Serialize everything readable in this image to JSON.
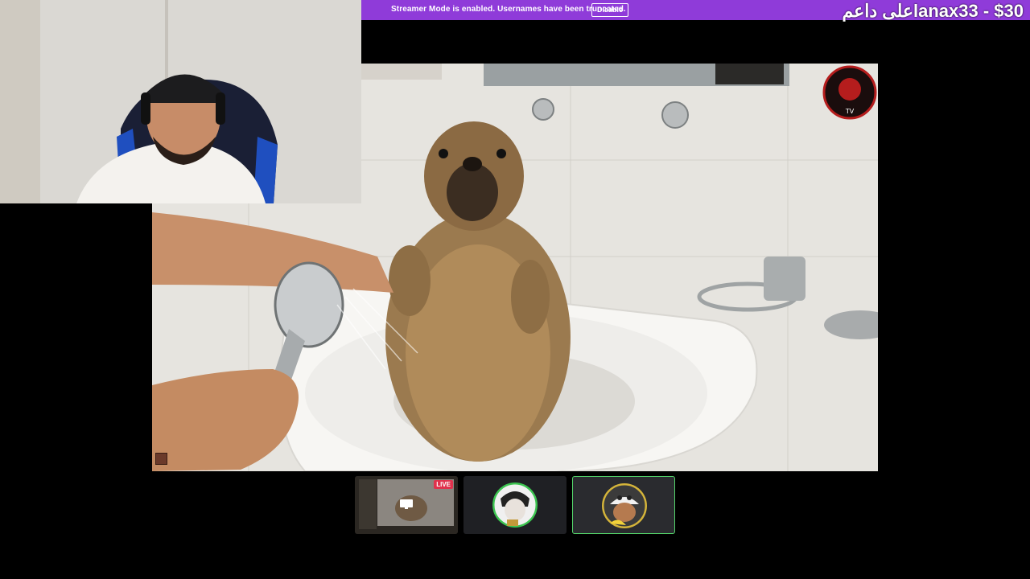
{
  "banner": {
    "message": "Streamer Mode is enabled. Usernames have been truncated.",
    "disable_label": "Disable"
  },
  "donation_text": "lanax33 - $30على داعم",
  "tiles": {
    "stream_preview": {
      "live_label": "LIVE",
      "icon": "screen-share-icon"
    },
    "participant_1": {
      "icon": "avatar-manga-character"
    },
    "participant_2": {
      "icon": "avatar-pirate-character"
    }
  },
  "colors": {
    "banner": "#8f3bd9",
    "live": "#e0324d",
    "active_border": "#53d36a"
  },
  "logo": {
    "text": "TV"
  }
}
